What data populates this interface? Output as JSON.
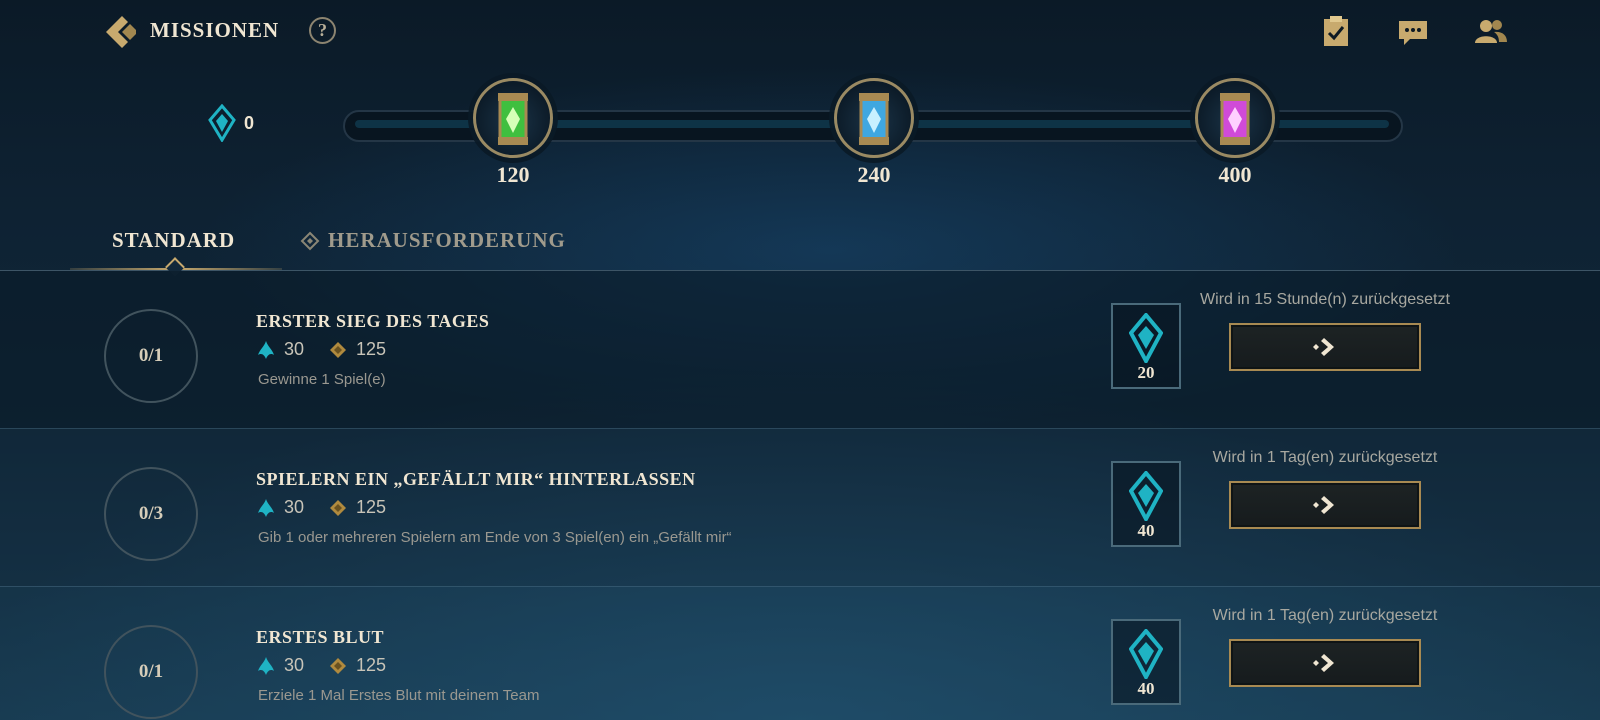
{
  "header": {
    "title": "MISSIONEN",
    "help_label": "?",
    "icons": [
      "back-chevron-icon",
      "help-icon",
      "mission-clipboard-icon",
      "chat-icon",
      "friends-icon"
    ]
  },
  "progress": {
    "currency_count": "0",
    "currency_icon": "mission-token-icon",
    "milestones": [
      {
        "value": "120",
        "capsule_color": "#3fbf3f"
      },
      {
        "value": "240",
        "capsule_color": "#3fa7e0"
      },
      {
        "value": "400",
        "capsule_color": "#d04ad8"
      }
    ]
  },
  "tabs": [
    {
      "label": "STANDARD",
      "active": true
    },
    {
      "label": "HERAUSFORDERUNG",
      "active": false
    }
  ],
  "missions": [
    {
      "progress": "0/1",
      "title": "ERSTER SIEG DES TAGES",
      "blue_essence": "30",
      "xp": "125",
      "description": "Gewinne 1 Spiel(e)",
      "token_reward": "20",
      "reset": "Wird in 15 Stunde(n) zurückgesetzt"
    },
    {
      "progress": "0/3",
      "title": "SPIELERN EIN „GEFÄLLT MIR“ HINTERLASSEN",
      "blue_essence": "30",
      "xp": "125",
      "description": "Gib 1 oder mehreren Spielern am Ende von 3 Spiel(en) ein „Gefällt mir“",
      "token_reward": "40",
      "reset": "Wird in 1 Tag(en) zurückgesetzt"
    },
    {
      "progress": "0/1",
      "title": "ERSTES BLUT",
      "blue_essence": "30",
      "xp": "125",
      "description": "Erziele 1 Mal Erstes Blut mit deinem Team",
      "token_reward": "40",
      "reset": "Wird in 1 Tag(en) zurückgesetzt"
    }
  ],
  "colors": {
    "gold": "#c8aa6e",
    "teal": "#1fb3c4",
    "text_light": "#f0e6d2",
    "background": "#0e2233"
  }
}
